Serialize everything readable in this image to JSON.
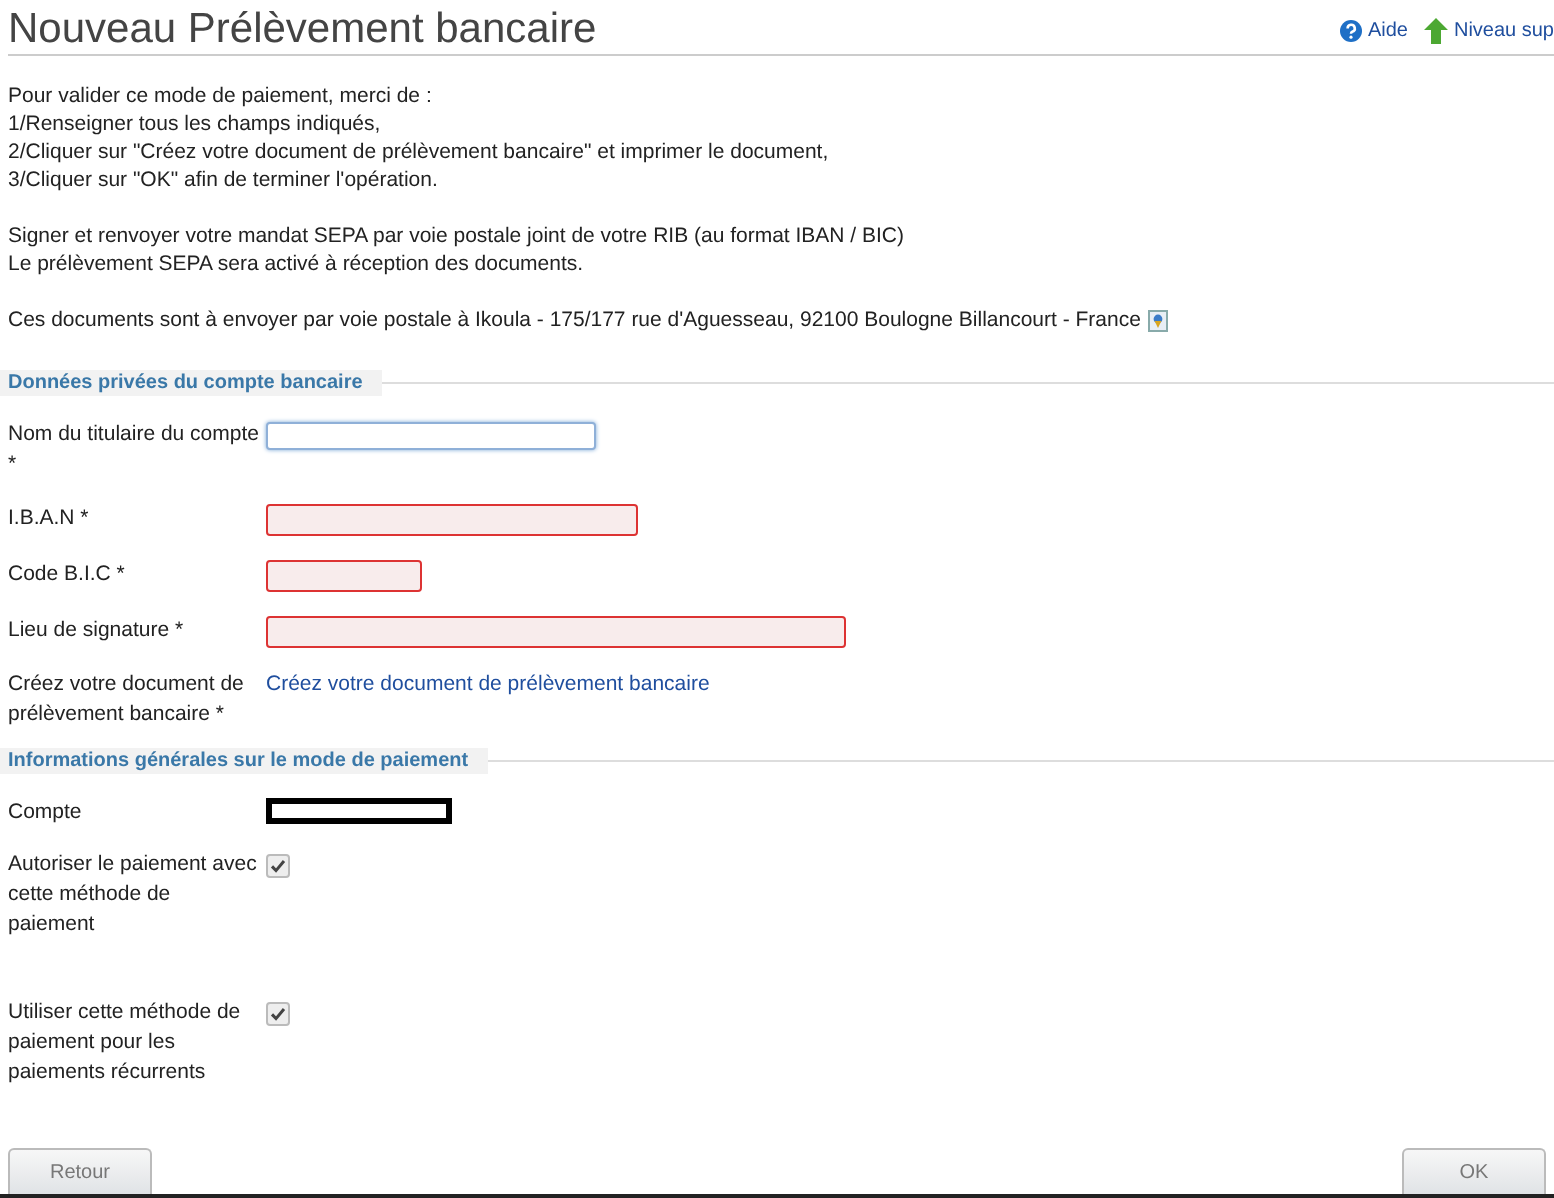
{
  "header": {
    "title": "Nouveau Prélèvement bancaire",
    "links": [
      {
        "label": "Aide",
        "kind": "help"
      },
      {
        "label": "Niveau sup",
        "kind": "up"
      }
    ]
  },
  "intro": {
    "lines": [
      "Pour valider ce mode de paiement, merci de :",
      "1/Renseigner tous les champs indiqués,",
      "2/Cliquer sur \"Créez votre document de prélèvement bancaire\" et imprimer le document,",
      "3/Cliquer sur \"OK\" afin de terminer l'opération."
    ],
    "sepa": [
      "Signer et renvoyer votre mandat SEPA par voie postale joint de votre RIB (au format IBAN / BIC)",
      "Le prélèvement SEPA sera activé à réception des documents."
    ],
    "address": "Ces documents sont à envoyer par voie postale à Ikoula - 175/177 rue d'Aguesseau, 92100 Boulogne Billancourt - France"
  },
  "sections": [
    {
      "title": "Données privées du compte bancaire",
      "rows": [
        {
          "label": "Nom du titulaire du compte *",
          "kind": "input",
          "invalid": false,
          "focused": true
        },
        {
          "label": "I.B.A.N *",
          "kind": "input",
          "invalid": true,
          "focused": false
        },
        {
          "label": "Code B.I.C *",
          "kind": "input",
          "invalid": true,
          "focused": false
        },
        {
          "label": "Lieu de signature *",
          "kind": "input",
          "invalid": true,
          "focused": false
        },
        {
          "label": "Créez votre document de prélèvement bancaire *",
          "kind": "link",
          "value": "Créez votre document de prélèvement bancaire"
        }
      ]
    },
    {
      "title": "Informations générales sur le mode de paiement",
      "rows": [
        {
          "label": "Compte",
          "kind": "redacted"
        },
        {
          "label": "Autoriser le paiement avec cette méthode de paiement",
          "kind": "checkbox",
          "checked": true
        },
        {
          "label": "Utiliser cette méthode de paiement pour les paiements récurrents",
          "kind": "checkbox",
          "checked": true
        }
      ]
    }
  ],
  "buttons": [
    {
      "label": "Retour"
    },
    {
      "label": "OK"
    }
  ]
}
